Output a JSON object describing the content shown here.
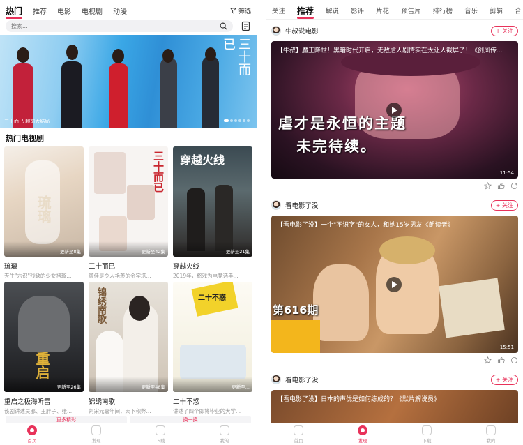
{
  "left": {
    "tabs": [
      "热门",
      "推荐",
      "电影",
      "电视剧",
      "动漫"
    ],
    "active_tab": 0,
    "filter_label": "筛选",
    "search_placeholder": "搜索...",
    "banner": {
      "caption": "三十而已 超前大结局",
      "calligraphy": "三十而已",
      "dots": 6,
      "active_dot": 0
    },
    "section_title": "热门电视剧",
    "shows": [
      {
        "title": "琉璃",
        "desc": "天生\"六识\"残缺的少女褚璇...",
        "update": "更新至8集",
        "poster_text": "琉璃"
      },
      {
        "title": "三十而已",
        "desc": "顾佳是令人艳羡的金字塔...",
        "update": "更新至42集",
        "poster_text": "三十而已"
      },
      {
        "title": "穿越火线",
        "desc": "2019年，憨戏为电竞选手...",
        "update": "更新至21集",
        "poster_text": "穿越火线"
      },
      {
        "title": "重启之极海听雷",
        "desc": "该剧讲述吴邪、王胖子、张...",
        "update": "更新至26集",
        "poster_text": "重启"
      },
      {
        "title": "锦绣南歌",
        "desc": "刘宋元嘉年间，天下积弊...",
        "update": "更新至48集",
        "poster_text": "锦绣南歌"
      },
      {
        "title": "二十不惑",
        "desc": "讲述了四个即将毕业的大学...",
        "update": "更新至...",
        "poster_text": "二十不惑"
      }
    ],
    "more_buttons": [
      "更多精彩",
      "换一换"
    ]
  },
  "right": {
    "tabs": [
      "关注",
      "推荐",
      "解说",
      "影评",
      "片花",
      "预告片",
      "排行榜",
      "音乐",
      "剪辑",
      "合"
    ],
    "active_tab": 1,
    "follow_label": "+ 关注",
    "posts": [
      {
        "author": "牛叔说电影",
        "title": "【牛叔】魔王降世！黑暗时代开启，无敌虐人剧情实在太让人截屏了！《剑风传...",
        "subtitle_line1": "虐才是永恒的主题",
        "subtitle_line2": "未完待续。",
        "duration": "11:54"
      },
      {
        "author": "看电影了没",
        "title": "【看电影了没】一个\"不识字\"的女人，和她15岁男友《朗读者》",
        "episode": "第616期",
        "duration": "15:51"
      },
      {
        "author": "看电影了没",
        "title": "【看电影了没】日本的声优是如何练成的？《默片解说员》"
      }
    ]
  },
  "nav_left": [
    "首页",
    "发现",
    "下载",
    "我的"
  ],
  "nav_left_active": 0,
  "nav_right": [
    "首页",
    "发现",
    "下载",
    "我的"
  ],
  "nav_right_active": 1,
  "colors": {
    "accent": "#e8325a"
  }
}
